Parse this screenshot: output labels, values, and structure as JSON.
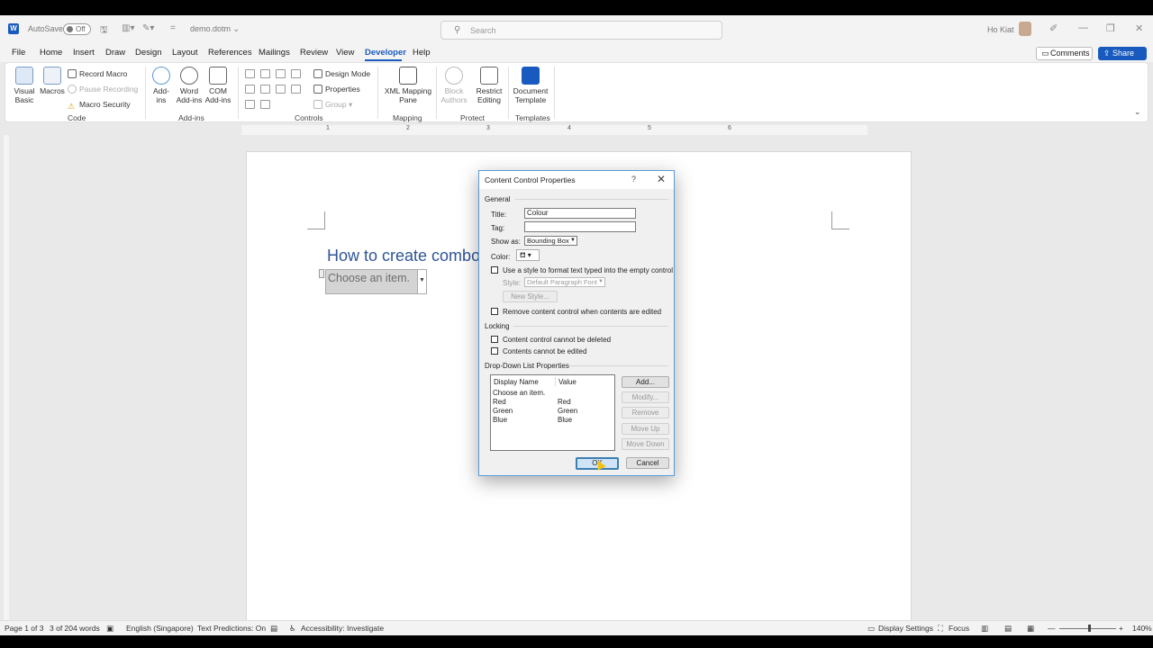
{
  "titlebar": {
    "autosave_label": "AutoSave",
    "autosave_state": "Off",
    "doc_name": "demo.dotm",
    "search_placeholder": "Search",
    "user_name": "Ho Kiat"
  },
  "menu": {
    "tabs": [
      "File",
      "Home",
      "Insert",
      "Draw",
      "Design",
      "Layout",
      "References",
      "Mailings",
      "Review",
      "View",
      "Developer",
      "Help"
    ],
    "active": "Developer",
    "comments": "Comments",
    "share": "Share"
  },
  "ribbon": {
    "code": {
      "visual_basic": "Visual Basic",
      "macros": "Macros",
      "record_macro": "Record Macro",
      "pause_recording": "Pause Recording",
      "macro_security": "Macro Security",
      "label": "Code"
    },
    "addins": {
      "addins": "Add-ins",
      "word_addins": "Word Add-ins",
      "com_addins": "COM Add-ins",
      "label": "Add-ins"
    },
    "controls": {
      "design_mode": "Design Mode",
      "properties": "Properties",
      "group": "Group",
      "label": "Controls"
    },
    "mapping": {
      "xml_mapping_pane": "XML Mapping Pane",
      "label": "Mapping"
    },
    "protect": {
      "block_authors": "Block Authors",
      "restrict_editing": "Restrict Editing",
      "label": "Protect"
    },
    "templates": {
      "document_template": "Document Template",
      "label": "Templates"
    }
  },
  "ruler": {
    "ticks": [
      "1",
      "2",
      "3",
      "4",
      "5",
      "6"
    ]
  },
  "document": {
    "heading": "How to create combo",
    "combo_placeholder": "Choose an item."
  },
  "dialog": {
    "title": "Content Control Properties",
    "help": "?",
    "close": "✕",
    "general": {
      "section": "General",
      "title_label": "Title:",
      "title_value": "Colour",
      "tag_label": "Tag:",
      "tag_value": "",
      "show_as_label": "Show as:",
      "show_as_value": "Bounding Box",
      "color_label": "Color:",
      "use_style_label": "Use a style to format text typed into the empty control",
      "style_label": "Style:",
      "style_value": "Default Paragraph Font",
      "new_style": "New Style...",
      "remove_control_label": "Remove content control when contents are edited"
    },
    "locking": {
      "section": "Locking",
      "cannot_delete": "Content control cannot be deleted",
      "cannot_edit": "Contents cannot be edited"
    },
    "dropdown": {
      "section": "Drop-Down List Properties",
      "headers": {
        "display": "Display Name",
        "value": "Value"
      },
      "rows": [
        {
          "display": "Choose an item.",
          "value": ""
        },
        {
          "display": "Red",
          "value": "Red"
        },
        {
          "display": "Green",
          "value": "Green"
        },
        {
          "display": "Blue",
          "value": "Blue"
        }
      ],
      "add": "Add...",
      "modify": "Modify...",
      "remove": "Remove",
      "move_up": "Move Up",
      "move_down": "Move Down"
    },
    "ok": "OK",
    "cancel": "Cancel"
  },
  "statusbar": {
    "page": "Page 1 of 3",
    "words": "3 of 204 words",
    "language": "English (Singapore)",
    "text_predictions": "Text Predictions: On",
    "accessibility": "Accessibility: Investigate",
    "display_settings": "Display Settings",
    "focus": "Focus",
    "zoom": "140%"
  },
  "colors": {
    "accent": "#185abd",
    "heading": "#2f5496",
    "dialog_border": "#5b9bd5"
  }
}
